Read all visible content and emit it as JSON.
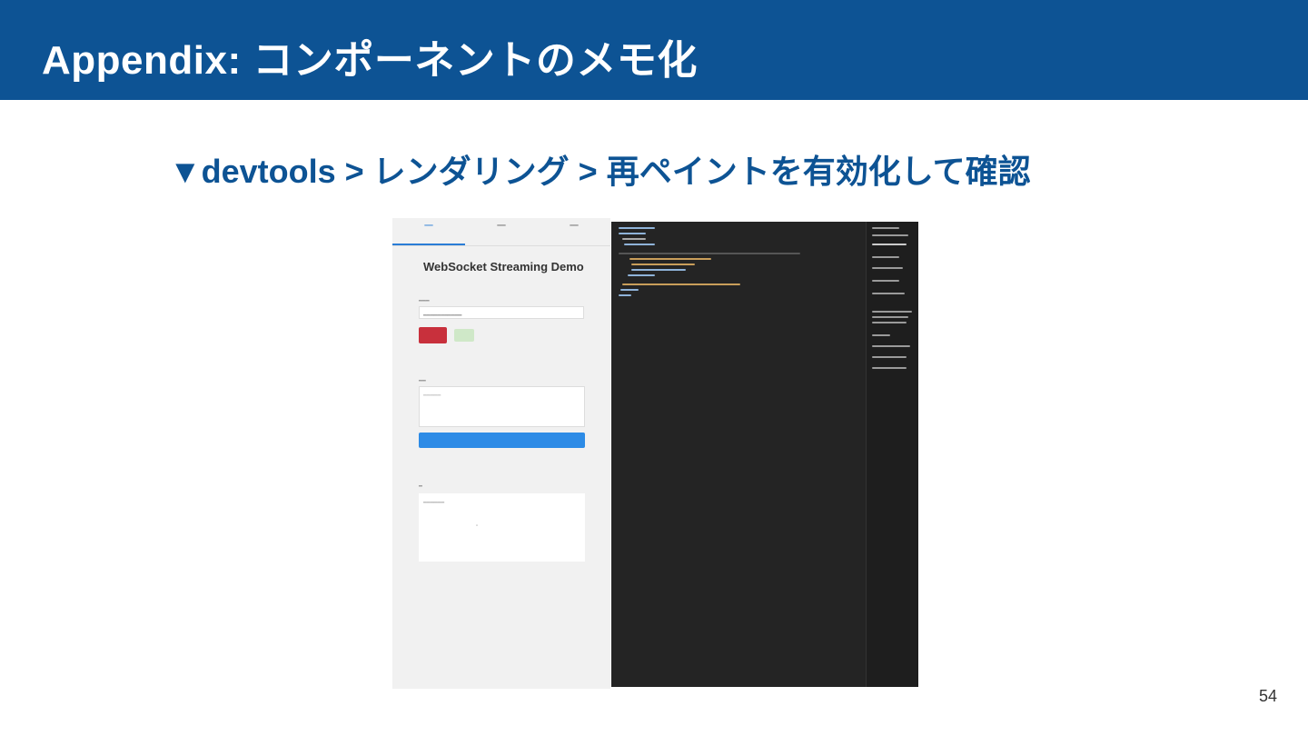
{
  "slide": {
    "title": "Appendix: コンポーネントのメモ化",
    "subtitle": "▼devtools > レンダリング  > 再ペイントを有効化して確認",
    "page_number": "54"
  },
  "screenshot": {
    "app_title": "WebSocket Streaming Demo"
  },
  "colors": {
    "header_bg": "#0d5394",
    "subtitle_text": "#0d5394",
    "devtools_bg": "#242424",
    "connect_button": "#c8303c",
    "send_button": "#2d8be6"
  }
}
